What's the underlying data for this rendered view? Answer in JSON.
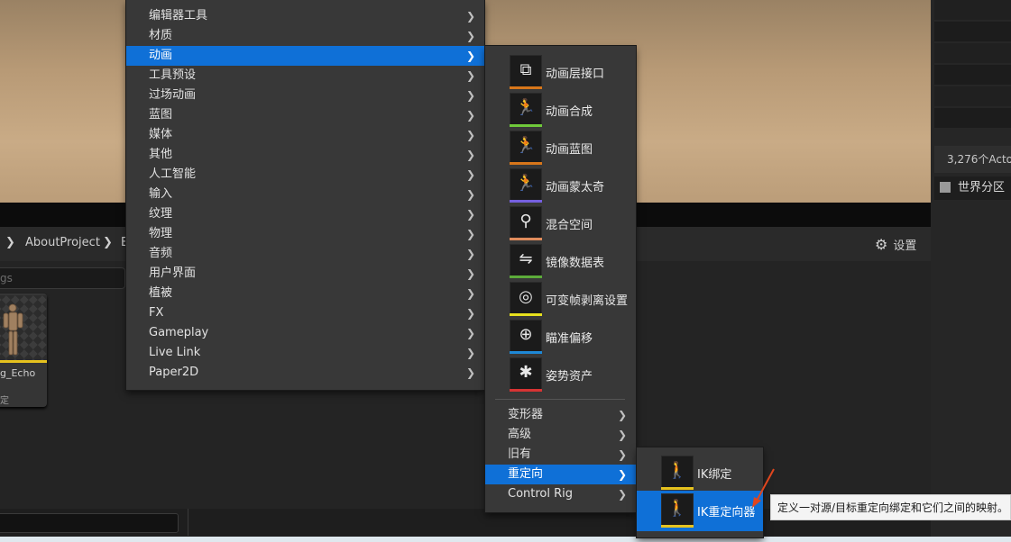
{
  "viewport": {
    "actor_count": "3,276个Acto",
    "world_partition": "世界分区"
  },
  "content_browser": {
    "breadcrumb": [
      "AboutProject",
      "E"
    ],
    "search_placeholder": "gs",
    "settings_label": "设置",
    "asset": {
      "name": "g_Echo",
      "type_hint": "定"
    }
  },
  "menu_main": {
    "items": [
      {
        "label": "编辑器工具",
        "selected": false
      },
      {
        "label": "材质",
        "selected": false
      },
      {
        "label": "动画",
        "selected": true
      },
      {
        "label": "工具预设",
        "selected": false
      },
      {
        "label": "过场动画",
        "selected": false
      },
      {
        "label": "蓝图",
        "selected": false
      },
      {
        "label": "媒体",
        "selected": false
      },
      {
        "label": "其他",
        "selected": false
      },
      {
        "label": "人工智能",
        "selected": false
      },
      {
        "label": "输入",
        "selected": false
      },
      {
        "label": "纹理",
        "selected": false
      },
      {
        "label": "物理",
        "selected": false
      },
      {
        "label": "音频",
        "selected": false
      },
      {
        "label": "用户界面",
        "selected": false
      },
      {
        "label": "植被",
        "selected": false
      },
      {
        "label": "FX",
        "selected": false
      },
      {
        "label": "Gameplay",
        "selected": false
      },
      {
        "label": "Live Link",
        "selected": false
      },
      {
        "label": "Paper2D",
        "selected": false
      }
    ]
  },
  "menu_animation": {
    "assets": [
      {
        "label": "动画层接口",
        "icon": "anim-layer-interface-icon",
        "color": "#d7761a"
      },
      {
        "label": "动画合成",
        "icon": "anim-composite-icon",
        "color": "#6fc93a"
      },
      {
        "label": "动画蓝图",
        "icon": "anim-blueprint-icon",
        "color": "#d7761a"
      },
      {
        "label": "动画蒙太奇",
        "icon": "anim-montage-icon",
        "color": "#7560e0"
      },
      {
        "label": "混合空间",
        "icon": "blend-space-icon",
        "color": "#e08c5c"
      },
      {
        "label": "镜像数据表",
        "icon": "mirror-table-icon",
        "color": "#5cab3a"
      },
      {
        "label": "可变帧剥离设置",
        "icon": "frame-strip-icon",
        "color": "#e6e01e"
      },
      {
        "label": "瞄准偏移",
        "icon": "aim-offset-icon",
        "color": "#1e88d6"
      },
      {
        "label": "姿势资产",
        "icon": "pose-asset-icon",
        "color": "#d63434"
      }
    ],
    "submenus": [
      {
        "label": "变形器",
        "selected": false
      },
      {
        "label": "高级",
        "selected": false
      },
      {
        "label": "旧有",
        "selected": false
      },
      {
        "label": "重定向",
        "selected": true
      },
      {
        "label": "Control Rig",
        "selected": false
      }
    ]
  },
  "menu_retarget": {
    "items": [
      {
        "label": "IK绑定",
        "icon": "ik-rig-icon",
        "color": "#e6c21e",
        "selected": false
      },
      {
        "label": "IK重定向器",
        "icon": "ik-retargeter-icon",
        "color": "#e6c21e",
        "selected": true
      }
    ]
  },
  "tooltip": "定义一对源/目标重定向绑定和它们之间的映射。",
  "accent_color": "#0f70d7"
}
